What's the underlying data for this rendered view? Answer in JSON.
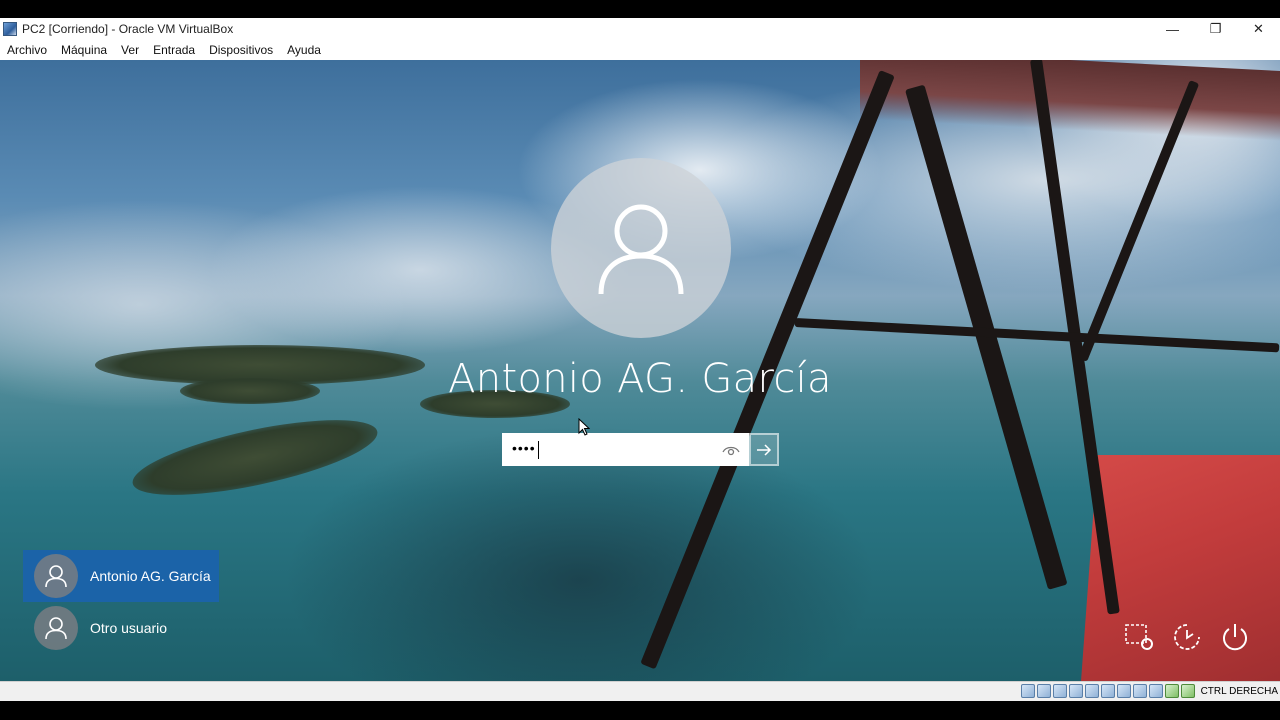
{
  "window": {
    "title": "PC2 [Corriendo] - Oracle VM VirtualBox",
    "buttons": {
      "minimize": "—",
      "restore": "❐",
      "close": "✕"
    }
  },
  "menu": {
    "items": [
      "Archivo",
      "Máquina",
      "Ver",
      "Entrada",
      "Dispositivos",
      "Ayuda"
    ]
  },
  "login": {
    "user_name": "Antonio AG. García",
    "password_value": "••••"
  },
  "user_list": {
    "items": [
      {
        "label": "Antonio AG. García",
        "selected": true
      },
      {
        "label": "Otro usuario",
        "selected": false
      }
    ]
  },
  "corner_icons": [
    "network-icon",
    "accessibility-icon",
    "power-icon"
  ],
  "status_bar": {
    "host_key": "CTRL DERECHA"
  },
  "colors": {
    "selected_user_bg": "#1b63a8",
    "window_bg": "#ffffff",
    "statusbar_bg": "#f0f0f0"
  }
}
